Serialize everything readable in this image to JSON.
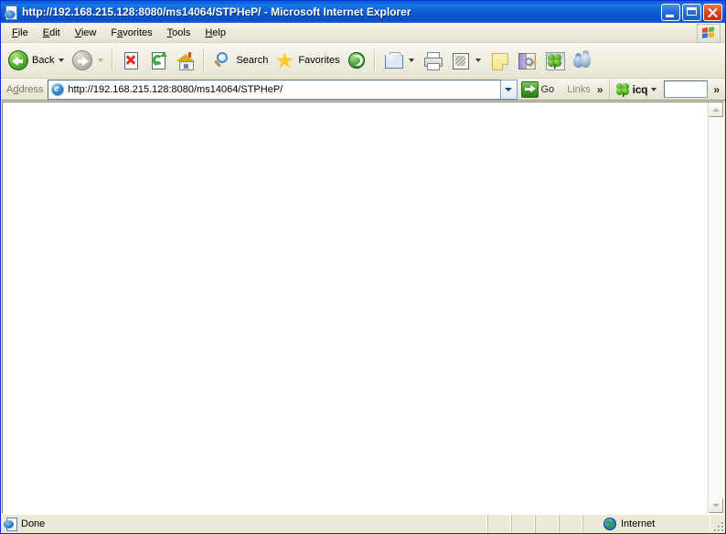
{
  "window": {
    "title": "http://192.168.215.128:8080/ms14064/STPHeP/ - Microsoft Internet Explorer",
    "title_icon": "ie-document-icon",
    "caption": {
      "minimize": "Minimize",
      "maximize": "Maximize",
      "close": "Close"
    }
  },
  "menubar": {
    "items": [
      {
        "label": "File",
        "accel": "F"
      },
      {
        "label": "Edit",
        "accel": "E"
      },
      {
        "label": "View",
        "accel": "V"
      },
      {
        "label": "Favorites",
        "accel": "a"
      },
      {
        "label": "Tools",
        "accel": "T"
      },
      {
        "label": "Help",
        "accel": "H"
      }
    ],
    "logo": "windows-flag-logo"
  },
  "toolbar": {
    "back_label": "Back",
    "buttons": [
      {
        "name": "back",
        "icon": "back-arrow-icon",
        "label": "Back",
        "enabled": true,
        "has_dropdown": true
      },
      {
        "name": "forward",
        "icon": "forward-arrow-icon",
        "label": "",
        "enabled": false,
        "has_dropdown": true
      },
      {
        "name": "stop",
        "icon": "stop-icon",
        "label": "",
        "enabled": true,
        "has_dropdown": false
      },
      {
        "name": "refresh",
        "icon": "refresh-icon",
        "label": "",
        "enabled": true,
        "has_dropdown": false
      },
      {
        "name": "home",
        "icon": "home-icon",
        "label": "",
        "enabled": true,
        "has_dropdown": false
      },
      {
        "name": "search",
        "icon": "search-icon",
        "label": "Search",
        "enabled": true,
        "has_dropdown": false
      },
      {
        "name": "favorites",
        "icon": "star-icon",
        "label": "Favorites",
        "enabled": true,
        "has_dropdown": false
      },
      {
        "name": "media",
        "icon": "media-globe-icon",
        "label": "",
        "enabled": true,
        "has_dropdown": false
      },
      {
        "name": "mail",
        "icon": "mail-icon",
        "label": "",
        "enabled": true,
        "has_dropdown": true
      },
      {
        "name": "print",
        "icon": "printer-icon",
        "label": "",
        "enabled": true,
        "has_dropdown": false
      },
      {
        "name": "edit",
        "icon": "edit-page-icon",
        "label": "",
        "enabled": true,
        "has_dropdown": true
      },
      {
        "name": "notes",
        "icon": "yellow-note-icon",
        "label": "",
        "enabled": true,
        "has_dropdown": false
      },
      {
        "name": "research",
        "icon": "research-icon",
        "label": "",
        "enabled": true,
        "has_dropdown": false
      },
      {
        "name": "icq",
        "icon": "icq-clover-icon",
        "label": "",
        "enabled": true,
        "has_dropdown": false
      },
      {
        "name": "messenger",
        "icon": "messenger-icon",
        "label": "",
        "enabled": true,
        "has_dropdown": false
      }
    ],
    "search_label": "Search",
    "favorites_label": "Favorites"
  },
  "address_bar": {
    "label": "Address",
    "label_accel": "d",
    "icon": "ie-globe-icon",
    "value": "http://192.168.215.128:8080/ms14064/STPHeP/",
    "placeholder": "",
    "dropdown_icon": "chevron-down-icon",
    "go_label": "Go",
    "go_icon": "go-arrow-icon",
    "links_label": "Links",
    "links_overflow": "»",
    "icq_label": "icq",
    "icq_icon": "icq-clover-icon",
    "icq_search_value": "",
    "toolbar_overflow": "»"
  },
  "content": {
    "page_text": "",
    "background": "#ffffff"
  },
  "scrollbar": {
    "up_icon": "scroll-up-arrow-icon",
    "down_icon": "scroll-down-arrow-icon"
  },
  "statusbar": {
    "status_text": "Done",
    "status_icon": "ie-document-icon",
    "zone_text": "Internet",
    "zone_icon": "internet-globe-icon",
    "resize_grip": "resize-grip"
  },
  "colors": {
    "titlebar_blue": "#0a56cf",
    "window_border": "#0831d9",
    "chrome_beige": "#ece9d8",
    "toolbar_gradient_top": "#f8f7f0",
    "content_white": "#ffffff",
    "go_green": "#3f9a2a",
    "stop_red": "#dc2b1e",
    "close_red": "#df4a22"
  }
}
